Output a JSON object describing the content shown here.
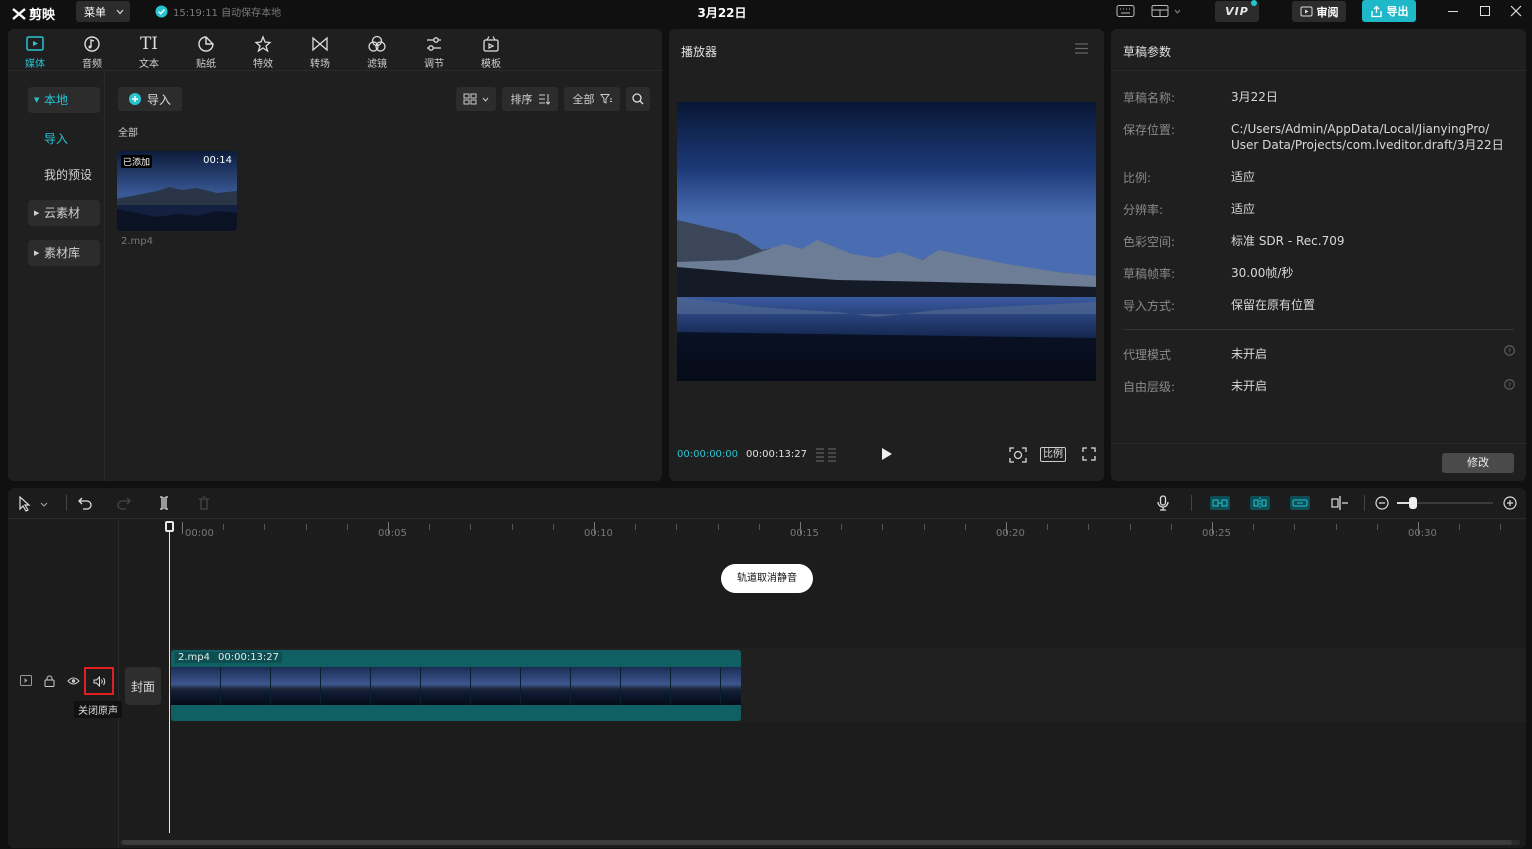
{
  "app": {
    "logo_text": "剪映",
    "menu_label": "菜单",
    "autosave_text": "15:19:11 自动保存本地",
    "project_title": "3月22日",
    "vip_label": "VIP",
    "review_label": "审阅",
    "export_label": "导出"
  },
  "toolbar": {
    "tabs": [
      {
        "label": "媒体",
        "icon": "media-icon"
      },
      {
        "label": "音频",
        "icon": "audio-icon"
      },
      {
        "label": "文本",
        "icon": "text-icon"
      },
      {
        "label": "贴纸",
        "icon": "sticker-icon"
      },
      {
        "label": "特效",
        "icon": "effects-icon"
      },
      {
        "label": "转场",
        "icon": "transition-icon"
      },
      {
        "label": "滤镜",
        "icon": "filter-icon"
      },
      {
        "label": "调节",
        "icon": "adjust-icon"
      },
      {
        "label": "模板",
        "icon": "template-icon"
      }
    ]
  },
  "sidebar": {
    "items": [
      "本地",
      "导入",
      "我的预设",
      "云素材",
      "素材库"
    ]
  },
  "media": {
    "import_label": "导入",
    "sort_label": "排序",
    "filter_label": "全部",
    "section_label": "全部",
    "clip": {
      "badge": "已添加",
      "duration": "00:14",
      "name": "2.mp4"
    }
  },
  "player": {
    "title": "播放器",
    "time_current": "00:00:00:00",
    "time_total": "00:00:13:27",
    "ratio_label": "比例"
  },
  "draft": {
    "title": "草稿参数",
    "props": [
      {
        "label": "草稿名称:",
        "value": "3月22日"
      },
      {
        "label": "保存位置:",
        "value": "C:/Users/Admin/AppData/Local/JianyingPro/",
        "value2": "User Data/Projects/com.lveditor.draft/3月22日"
      },
      {
        "label": "比例:",
        "value": "适应"
      },
      {
        "label": "分辨率:",
        "value": "适应"
      },
      {
        "label": "色彩空间:",
        "value": "标准 SDR - Rec.709"
      },
      {
        "label": "草稿帧率:",
        "value": "30.00帧/秒"
      },
      {
        "label": "导入方式:",
        "value": "保留在原有位置"
      },
      {
        "label": "代理模式",
        "value": "未开启"
      },
      {
        "label": "自由层级:",
        "value": "未开启"
      }
    ],
    "modify_label": "修改"
  },
  "timeline": {
    "ruler": [
      "00:00",
      "00:05",
      "00:10",
      "00:15",
      "00:20",
      "00:25",
      "00:30"
    ],
    "toast": "轨道取消静音",
    "cover_label": "封面",
    "mute_tooltip": "关闭原声",
    "clip": {
      "name": "2.mp4",
      "duration": "00:00:13:27"
    }
  },
  "colors": {
    "accent": "#28c4d2",
    "clip": "#0f5f63",
    "highlight_box": "#e02020"
  }
}
